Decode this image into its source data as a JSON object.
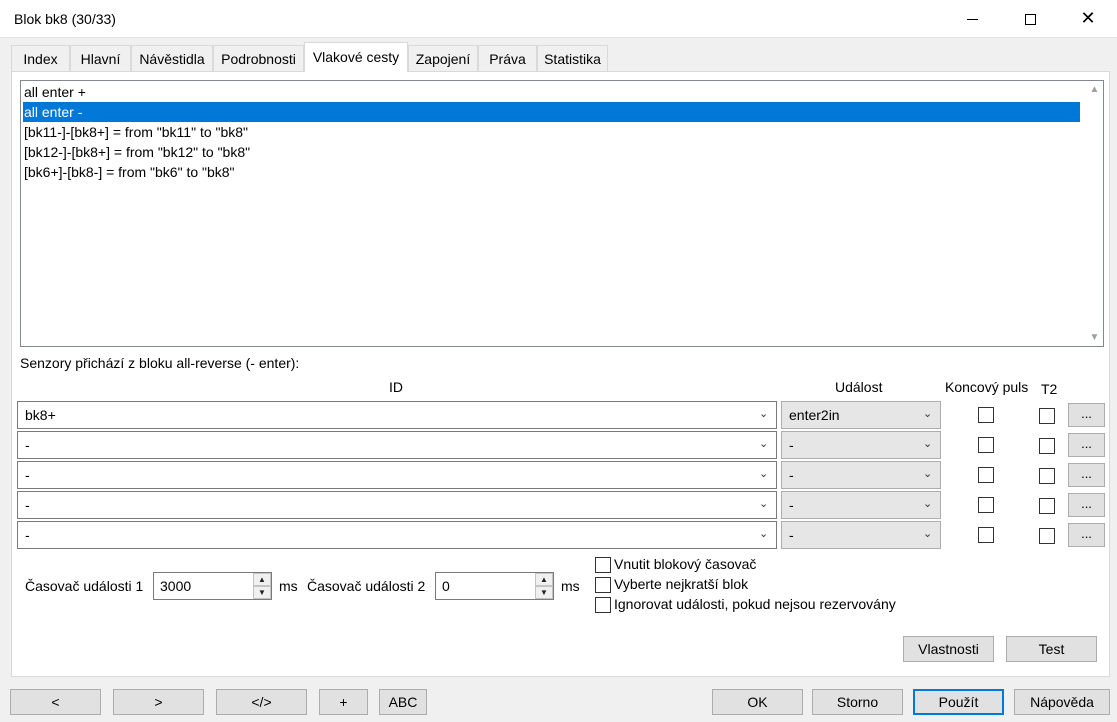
{
  "window": {
    "title": "Blok bk8 (30/33)",
    "minimize_icon": "minimize-icon",
    "maximize_icon": "maximize-icon",
    "close_icon": "close-icon",
    "close_glyph": "✕"
  },
  "tabs": [
    {
      "label": "Index"
    },
    {
      "label": "Hlavní"
    },
    {
      "label": "Návěstidla"
    },
    {
      "label": "Podrobnosti"
    },
    {
      "label": "Vlakové cesty",
      "active": true
    },
    {
      "label": "Zapojení"
    },
    {
      "label": "Práva"
    },
    {
      "label": "Statistika"
    }
  ],
  "routes": {
    "items": [
      "all enter +",
      "all enter -",
      "[bk11-]-[bk8+] = from \"bk11\" to \"bk8\"",
      "[bk12-]-[bk8+] = from \"bk12\" to \"bk8\"",
      "[bk6+]-[bk8-] = from \"bk6\" to \"bk8\""
    ],
    "selected_index": 1,
    "scroll_up": "▲",
    "scroll_down": "▼"
  },
  "sensors": {
    "label": "Senzory přichází z bloku all-reverse (- enter):",
    "headers": {
      "id": "ID",
      "event": "Událost",
      "end_pulse": "Koncový puls",
      "t2": "T2"
    },
    "chevron": "⌄",
    "more_label": "...",
    "rows": [
      {
        "id": "bk8+",
        "event": "enter2in",
        "end_pulse": false,
        "t2": false
      },
      {
        "id": "-",
        "event": "-",
        "end_pulse": false,
        "t2": false
      },
      {
        "id": "-",
        "event": "-",
        "end_pulse": false,
        "t2": false
      },
      {
        "id": "-",
        "event": "-",
        "end_pulse": false,
        "t2": false
      },
      {
        "id": "-",
        "event": "-",
        "end_pulse": false,
        "t2": false
      }
    ]
  },
  "timers": {
    "timer1_label": "Časovač události 1",
    "timer1_value": "3000",
    "timer1_unit": "ms",
    "timer2_label": "Časovač události 2",
    "timer2_value": "0",
    "timer2_unit": "ms",
    "spin_up": "▲",
    "spin_down": "▼"
  },
  "options": [
    {
      "label": "Vnutit blokový časovač",
      "checked": false
    },
    {
      "label": "Vyberte nejkratší blok",
      "checked": false
    },
    {
      "label": "Ignorovat události, pokud nejsou rezervovány",
      "checked": false
    }
  ],
  "panel_buttons": {
    "properties": "Vlastnosti",
    "test": "Test"
  },
  "footer": {
    "prev": "<",
    "next": ">",
    "code": "</>",
    "add": "+",
    "abc": "ABC",
    "ok": "OK",
    "cancel": "Storno",
    "apply": "Použít",
    "help": "Nápověda"
  }
}
